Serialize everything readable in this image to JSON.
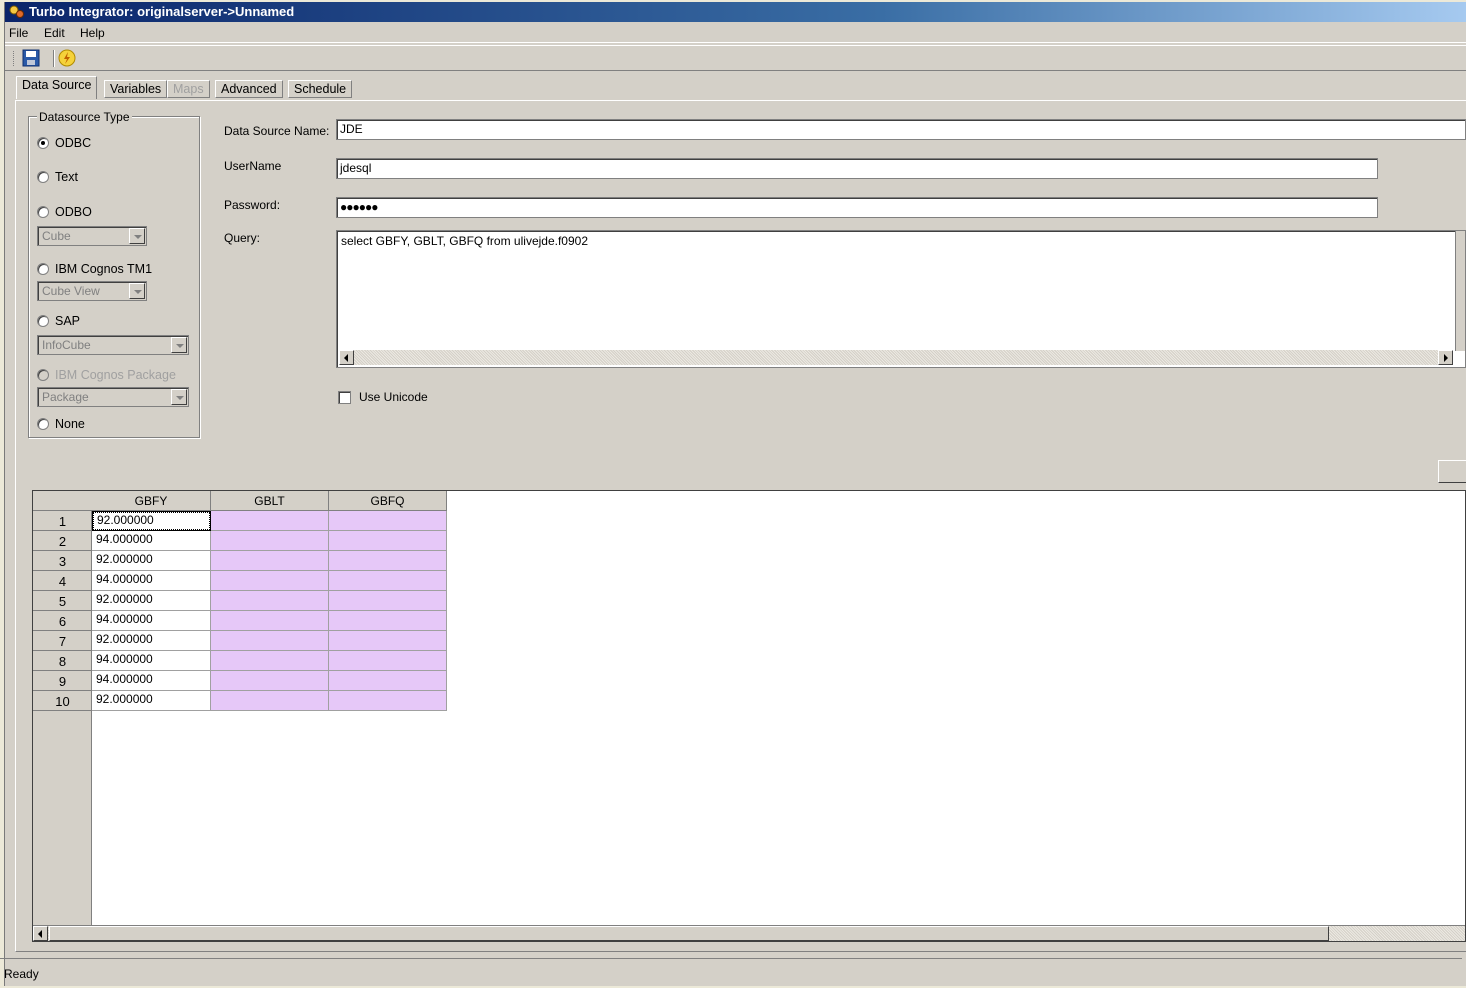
{
  "window": {
    "title": "Turbo Integrator:  originalserver->Unnamed"
  },
  "menu": {
    "file": "File",
    "edit": "Edit",
    "help": "Help"
  },
  "toolbar": {
    "save_icon": "save-icon",
    "run_icon": "run-icon"
  },
  "tabs": [
    {
      "label": "Data Source",
      "active": true,
      "enabled": true
    },
    {
      "label": "Variables",
      "active": false,
      "enabled": true
    },
    {
      "label": "Maps",
      "active": false,
      "enabled": false
    },
    {
      "label": "Advanced",
      "active": false,
      "enabled": true
    },
    {
      "label": "Schedule",
      "active": false,
      "enabled": true
    }
  ],
  "datasource_type": {
    "legend": "Datasource Type",
    "options": {
      "odbc": "ODBC",
      "text": "Text",
      "odbo": "ODBO",
      "tm1": "IBM Cognos TM1",
      "sap": "SAP",
      "package": "IBM Cognos Package",
      "none": "None"
    },
    "selected": "ODBC",
    "combos": {
      "odbo": "Cube",
      "tm1": "Cube View",
      "sap": "InfoCube",
      "package": "Package"
    }
  },
  "form": {
    "ds_name_label": "Data Source Name:",
    "ds_name_value": "JDE",
    "username_label": "UserName",
    "username_value": "jdesql",
    "password_label": "Password:",
    "password_value": "●●●●●●",
    "query_label": "Query:",
    "query_value": "select GBFY, GBLT, GBFQ from ulivejde.f0902",
    "unicode_label": "Use Unicode",
    "unicode_checked": false
  },
  "grid": {
    "columns": [
      "GBFY",
      "GBLT",
      "GBFQ"
    ],
    "rows": [
      {
        "n": "1",
        "gbfy": "92.000000"
      },
      {
        "n": "2",
        "gbfy": "94.000000"
      },
      {
        "n": "3",
        "gbfy": "92.000000"
      },
      {
        "n": "4",
        "gbfy": "94.000000"
      },
      {
        "n": "5",
        "gbfy": "92.000000"
      },
      {
        "n": "6",
        "gbfy": "94.000000"
      },
      {
        "n": "7",
        "gbfy": "92.000000"
      },
      {
        "n": "8",
        "gbfy": "94.000000"
      },
      {
        "n": "9",
        "gbfy": "94.000000"
      },
      {
        "n": "10",
        "gbfy": "92.000000"
      }
    ],
    "empty_cell_color": "#e6c8f8"
  },
  "status": {
    "text": "Ready"
  }
}
